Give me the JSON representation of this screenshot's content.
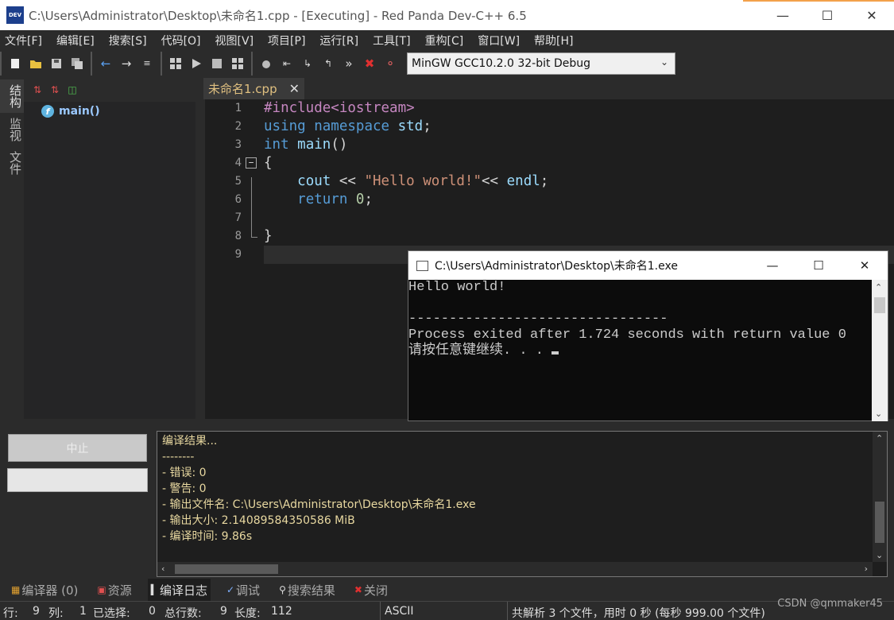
{
  "window": {
    "title": "C:\\Users\\Administrator\\Desktop\\未命名1.cpp - [Executing] - Red Panda Dev-C++ 6.5",
    "app_icon_text": "DEV",
    "minimize": "—",
    "maximize": "☐",
    "close": "✕"
  },
  "menu": [
    "文件[F]",
    "编辑[E]",
    "搜索[S]",
    "代码[O]",
    "视图[V]",
    "项目[P]",
    "运行[R]",
    "工具[T]",
    "重构[C]",
    "窗口[W]",
    "帮助[H]"
  ],
  "toolbar": {
    "compiler_select": "MinGW GCC10.2.0 32-bit Debug"
  },
  "left_tabs": [
    "结构",
    "监视",
    "文件"
  ],
  "structure": {
    "items": [
      {
        "icon": "f",
        "label": "main()"
      }
    ]
  },
  "editor": {
    "tab_label": "未命名1.cpp",
    "tab_close": "✕",
    "line_numbers": [
      "1",
      "2",
      "3",
      "4",
      "5",
      "6",
      "7",
      "8",
      "9"
    ],
    "fold_symbol": "−"
  },
  "console": {
    "title": "C:\\Users\\Administrator\\Desktop\\未命名1.exe",
    "lines": [
      "Hello world!",
      "",
      "--------------------------------",
      "Process exited after 1.724 seconds with return value 0",
      "请按任意键继续. . . "
    ]
  },
  "compile": {
    "abort_label": "中止",
    "log_lines": [
      "编译结果...",
      "--------",
      "- 错误: 0",
      "- 警告: 0",
      "- 输出文件名: C:\\Users\\Administrator\\Desktop\\未命名1.exe",
      "- 输出大小: 2.14089584350586 MiB",
      "- 编译时间: 9.86s"
    ]
  },
  "bottom_tabs": [
    "编译器 (0)",
    "资源",
    "编译日志",
    "调试",
    "搜索结果",
    "关闭"
  ],
  "status": {
    "row_label": "行:",
    "row": "9",
    "col_label": "列:",
    "col": "1",
    "selected_label": "已选择:",
    "selected": "0",
    "total_label": "总行数:",
    "total": "9",
    "length_label": "长度:",
    "length": "112",
    "encoding": "ASCII",
    "parse_info": "共解析 3 个文件，用时 0 秒 (每秒 999.00 个文件)"
  },
  "watermark": "CSDN @qmmaker45",
  "colors": {
    "background": "#2b2b2b",
    "editor_bg": "#1e1e1e",
    "keyword": "#569cd6",
    "preprocessor": "#c586c0",
    "string": "#ce9178"
  }
}
